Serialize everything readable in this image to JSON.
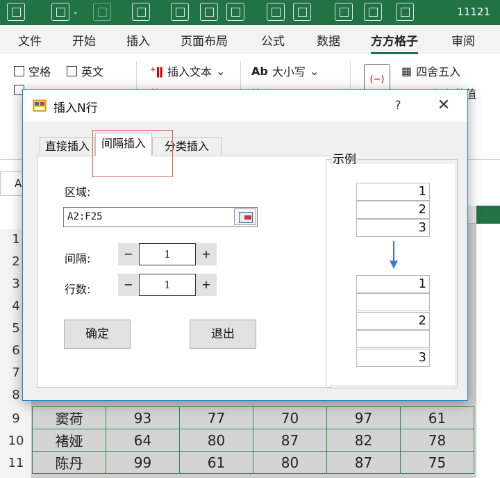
{
  "excel": {
    "doc_number": "11121",
    "ribbon_tabs": [
      "文件",
      "开始",
      "插入",
      "页面布局",
      "公式",
      "数据",
      "方方格子",
      "审阅"
    ],
    "active_tab": "方方格子",
    "ribbon": {
      "space_label": "空格",
      "english_label": "英文",
      "insert_text_label": "插入文本",
      "case_label": "大小写",
      "case_prefix": "Ab",
      "round_label": "四舍五入",
      "keep_value_label": "只保留数值"
    },
    "name_box": "A",
    "row_numbers": [
      "1",
      "2",
      "3",
      "4",
      "5",
      "6",
      "7",
      "8",
      "9",
      "10",
      "11"
    ],
    "visible_rows": [
      {
        "name": "窦荷",
        "values": [
          "93",
          "77",
          "70",
          "97",
          "61"
        ]
      },
      {
        "name": "褚娅",
        "values": [
          "64",
          "80",
          "87",
          "82",
          "78"
        ]
      },
      {
        "name": "陈丹",
        "values": [
          "99",
          "61",
          "80",
          "87",
          "75"
        ]
      }
    ]
  },
  "dialog": {
    "title": "插入N行",
    "help": "?",
    "close": "✕",
    "tabs": [
      "直接插入",
      "间隔插入",
      "分类插入"
    ],
    "active_tab": "间隔插入",
    "region_label": "区域:",
    "region_value": "A2:F25",
    "interval_label": "间隔:",
    "interval_value": "1",
    "rows_label": "行数:",
    "rows_value": "1",
    "minus": "−",
    "plus": "+",
    "ok_label": "确定",
    "exit_label": "退出",
    "example_title": "示例",
    "example_before": [
      "1",
      "2",
      "3"
    ],
    "example_after": [
      "1",
      "",
      "2",
      "",
      "3"
    ]
  },
  "colors": {
    "excel_green": "#217346",
    "dialog_border": "#1883d7",
    "highlight_red": "#e06060",
    "arrow_blue": "#3f79c8"
  }
}
